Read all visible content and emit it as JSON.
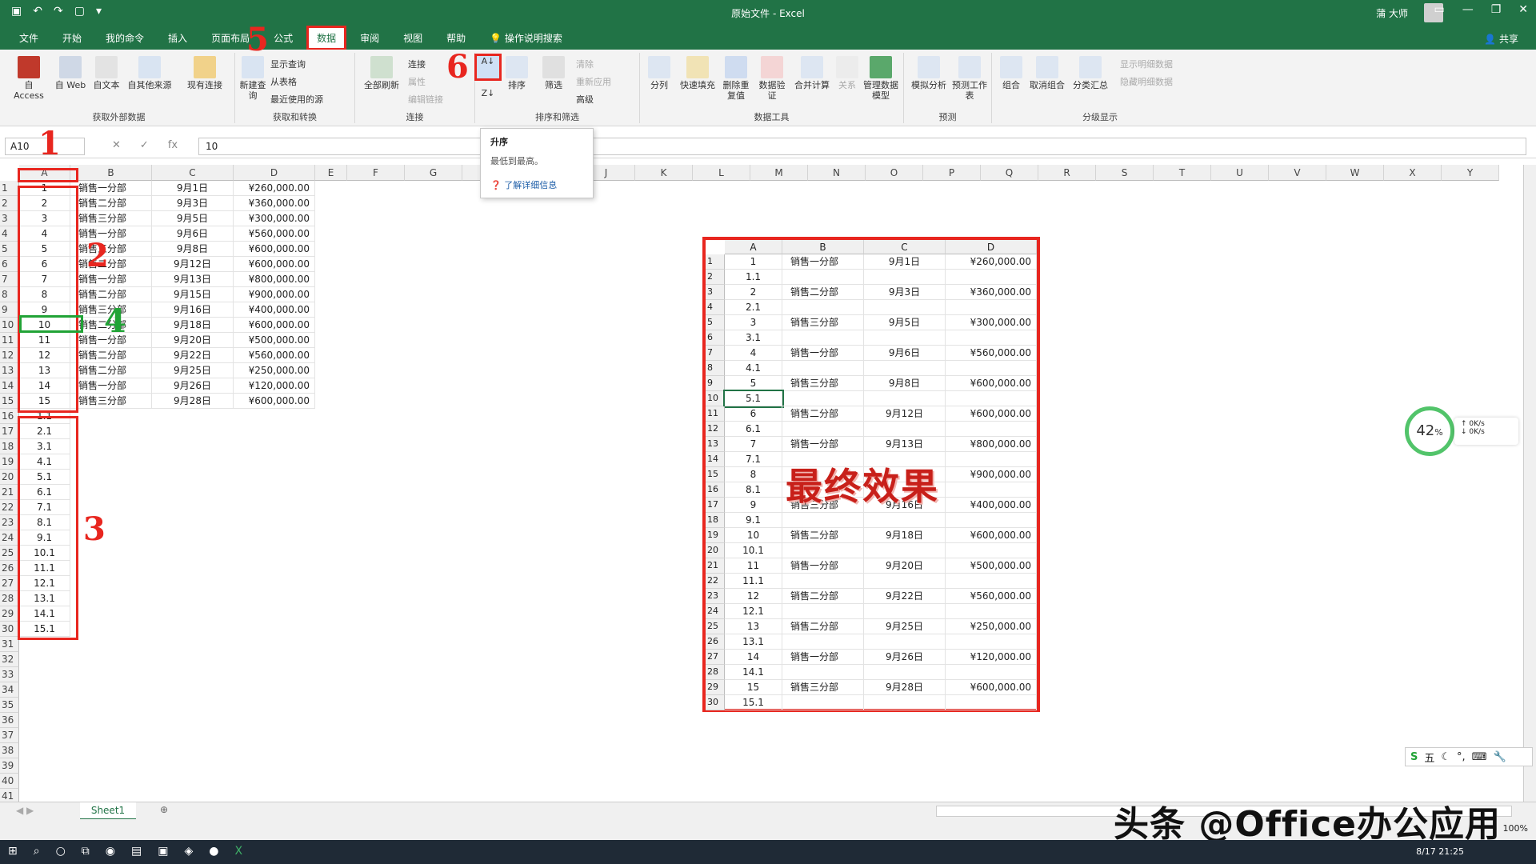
{
  "window": {
    "title": "原始文件  -  Excel",
    "user": "蒲 大师"
  },
  "menu_tabs": [
    "文件",
    "开始",
    "我的命令",
    "插入",
    "页面布局",
    "公式",
    "数据",
    "审阅",
    "视图",
    "帮助"
  ],
  "search_hint": "操作说明搜索",
  "share_label": "共享",
  "ribbon": {
    "get_external": {
      "label": "获取外部数据",
      "buttons": [
        "自 Access",
        "自 Web",
        "自文本",
        "自其他来源",
        "现有连接"
      ]
    },
    "get_transform": {
      "label": "获取和转换",
      "big": "新建查询",
      "items": [
        "显示查询",
        "从表格",
        "最近使用的源"
      ]
    },
    "connections": {
      "label": "连接",
      "big": "全部刷新",
      "items": [
        "连接",
        "属性",
        "编辑链接"
      ]
    },
    "sort_filter": {
      "label": "排序和筛选",
      "buttons": [
        "排序",
        "筛选"
      ],
      "items": [
        "清除",
        "重新应用",
        "高级"
      ]
    },
    "data_tools": {
      "label": "数据工具",
      "buttons": [
        "分列",
        "快速填充",
        "删除重复值",
        "数据验证",
        "合并计算",
        "关系",
        "管理数据模型"
      ]
    },
    "forecast": {
      "label": "预测",
      "buttons": [
        "模拟分析",
        "预测工作表"
      ]
    },
    "outline": {
      "label": "分级显示",
      "buttons": [
        "组合",
        "取消组合",
        "分类汇总"
      ],
      "items": [
        "显示明细数据",
        "隐藏明细数据"
      ]
    }
  },
  "tooltip": {
    "title": "升序",
    "desc": "最低到最高。",
    "link": "了解详细信息"
  },
  "formula_bar": {
    "namebox": "A10",
    "value": "10"
  },
  "columns": [
    "A",
    "B",
    "C",
    "D",
    "E",
    "F",
    "G",
    "H",
    "I",
    "J",
    "K",
    "L",
    "M",
    "N",
    "O",
    "P",
    "Q",
    "R",
    "S",
    "T",
    "U",
    "V",
    "W",
    "X",
    "Y"
  ],
  "rows": [
    "1",
    "2",
    "3",
    "4",
    "5",
    "6",
    "7",
    "8",
    "9",
    "10",
    "11",
    "12",
    "13",
    "14",
    "15",
    "16",
    "17",
    "18",
    "19",
    "20",
    "21",
    "22",
    "23",
    "24",
    "25",
    "26",
    "27",
    "28",
    "29",
    "30",
    "31",
    "32",
    "33",
    "34",
    "35",
    "36",
    "37",
    "38",
    "39",
    "40",
    "41"
  ],
  "main_data": [
    [
      "1",
      "销售一分部",
      "9月1日",
      "¥260,000.00"
    ],
    [
      "2",
      "销售二分部",
      "9月3日",
      "¥360,000.00"
    ],
    [
      "3",
      "销售三分部",
      "9月5日",
      "¥300,000.00"
    ],
    [
      "4",
      "销售一分部",
      "9月6日",
      "¥560,000.00"
    ],
    [
      "5",
      "销售三分部",
      "9月8日",
      "¥600,000.00"
    ],
    [
      "6",
      "销售二分部",
      "9月12日",
      "¥600,000.00"
    ],
    [
      "7",
      "销售一分部",
      "9月13日",
      "¥800,000.00"
    ],
    [
      "8",
      "销售二分部",
      "9月15日",
      "¥900,000.00"
    ],
    [
      "9",
      "销售三分部",
      "9月16日",
      "¥400,000.00"
    ],
    [
      "10",
      "销售二分部",
      "9月18日",
      "¥600,000.00"
    ],
    [
      "11",
      "销售一分部",
      "9月20日",
      "¥500,000.00"
    ],
    [
      "12",
      "销售二分部",
      "9月22日",
      "¥560,000.00"
    ],
    [
      "13",
      "销售二分部",
      "9月25日",
      "¥250,000.00"
    ],
    [
      "14",
      "销售一分部",
      "9月26日",
      "¥120,000.00"
    ],
    [
      "15",
      "销售三分部",
      "9月28日",
      "¥600,000.00"
    ]
  ],
  "helper_values": [
    "1.1",
    "2.1",
    "3.1",
    "4.1",
    "5.1",
    "6.1",
    "7.1",
    "8.1",
    "9.1",
    "10.1",
    "11.1",
    "12.1",
    "13.1",
    "14.1",
    "15.1"
  ],
  "annotations": [
    "1",
    "2",
    "3",
    "4",
    "5",
    "6"
  ],
  "final_label": "最终效果",
  "inner": {
    "cols": [
      "A",
      "B",
      "C",
      "D"
    ],
    "rows": [
      [
        "1",
        "销售一分部",
        "9月1日",
        "¥260,000.00"
      ],
      [
        "1.1",
        "",
        "",
        ""
      ],
      [
        "2",
        "销售二分部",
        "9月3日",
        "¥360,000.00"
      ],
      [
        "2.1",
        "",
        "",
        ""
      ],
      [
        "3",
        "销售三分部",
        "9月5日",
        "¥300,000.00"
      ],
      [
        "3.1",
        "",
        "",
        ""
      ],
      [
        "4",
        "销售一分部",
        "9月6日",
        "¥560,000.00"
      ],
      [
        "4.1",
        "",
        "",
        ""
      ],
      [
        "5",
        "销售三分部",
        "9月8日",
        "¥600,000.00"
      ],
      [
        "5.1",
        "",
        "",
        ""
      ],
      [
        "6",
        "销售二分部",
        "9月12日",
        "¥600,000.00"
      ],
      [
        "6.1",
        "",
        "",
        ""
      ],
      [
        "7",
        "销售一分部",
        "9月13日",
        "¥800,000.00"
      ],
      [
        "7.1",
        "",
        "",
        ""
      ],
      [
        "8",
        "",
        "",
        "¥900,000.00"
      ],
      [
        "8.1",
        "",
        "",
        ""
      ],
      [
        "9",
        "销售三分部",
        "9月16日",
        "¥400,000.00"
      ],
      [
        "9.1",
        "",
        "",
        ""
      ],
      [
        "10",
        "销售二分部",
        "9月18日",
        "¥600,000.00"
      ],
      [
        "10.1",
        "",
        "",
        ""
      ],
      [
        "11",
        "销售一分部",
        "9月20日",
        "¥500,000.00"
      ],
      [
        "11.1",
        "",
        "",
        ""
      ],
      [
        "12",
        "销售二分部",
        "9月22日",
        "¥560,000.00"
      ],
      [
        "12.1",
        "",
        "",
        ""
      ],
      [
        "13",
        "销售二分部",
        "9月25日",
        "¥250,000.00"
      ],
      [
        "13.1",
        "",
        "",
        ""
      ],
      [
        "14",
        "销售一分部",
        "9月26日",
        "¥120,000.00"
      ],
      [
        "14.1",
        "",
        "",
        ""
      ],
      [
        "15",
        "销售三分部",
        "9月28日",
        "¥600,000.00"
      ],
      [
        "15.1",
        "",
        "",
        ""
      ]
    ]
  },
  "gauge": {
    "value": "42",
    "unit": "%",
    "up": "0K/s",
    "down": "0K/s"
  },
  "ime": {
    "mode": "五"
  },
  "sheet_tab": "Sheet1",
  "zoom": "100%",
  "watermark": "头条 @Office办公应用",
  "clock": "8/17 21:25",
  "colors": {
    "excel_green": "#217346",
    "highlight_red": "#e8261f",
    "select_green": "#21a336"
  }
}
